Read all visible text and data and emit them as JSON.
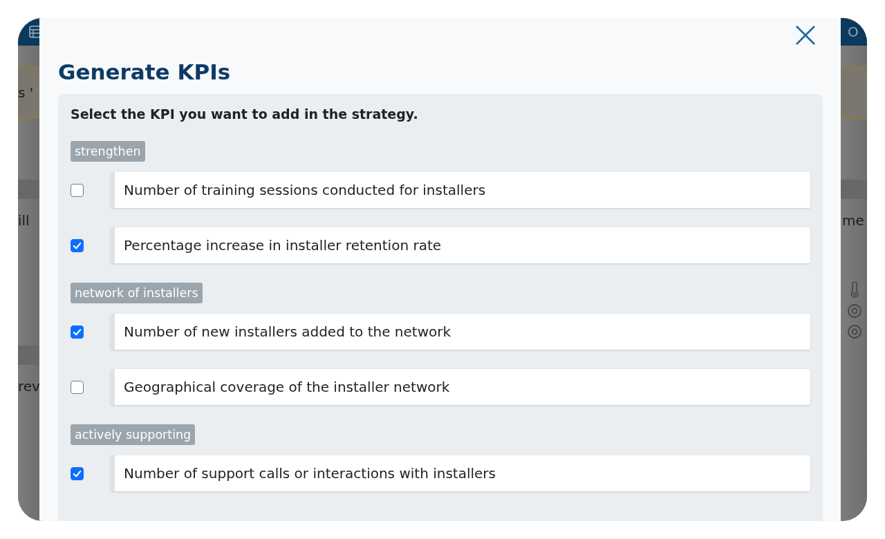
{
  "background": {
    "left_texts": [
      "s '",
      "ill",
      "rev"
    ],
    "right_texts": [
      "O",
      "me"
    ]
  },
  "dialog": {
    "title": "Generate KPIs",
    "instruction": "Select the KPI you want to add in the strategy.",
    "groups": [
      {
        "label": "strengthen",
        "items": [
          {
            "text": "Number of training sessions conducted for installers",
            "checked": false
          },
          {
            "text": "Percentage increase in installer retention rate",
            "checked": true
          }
        ]
      },
      {
        "label": "network of installers",
        "items": [
          {
            "text": "Number of new installers added to the network",
            "checked": true
          },
          {
            "text": "Geographical coverage of the installer network",
            "checked": false
          }
        ]
      },
      {
        "label": "actively supporting",
        "items": [
          {
            "text": "Number of support calls or interactions with installers",
            "checked": true
          }
        ]
      }
    ]
  }
}
